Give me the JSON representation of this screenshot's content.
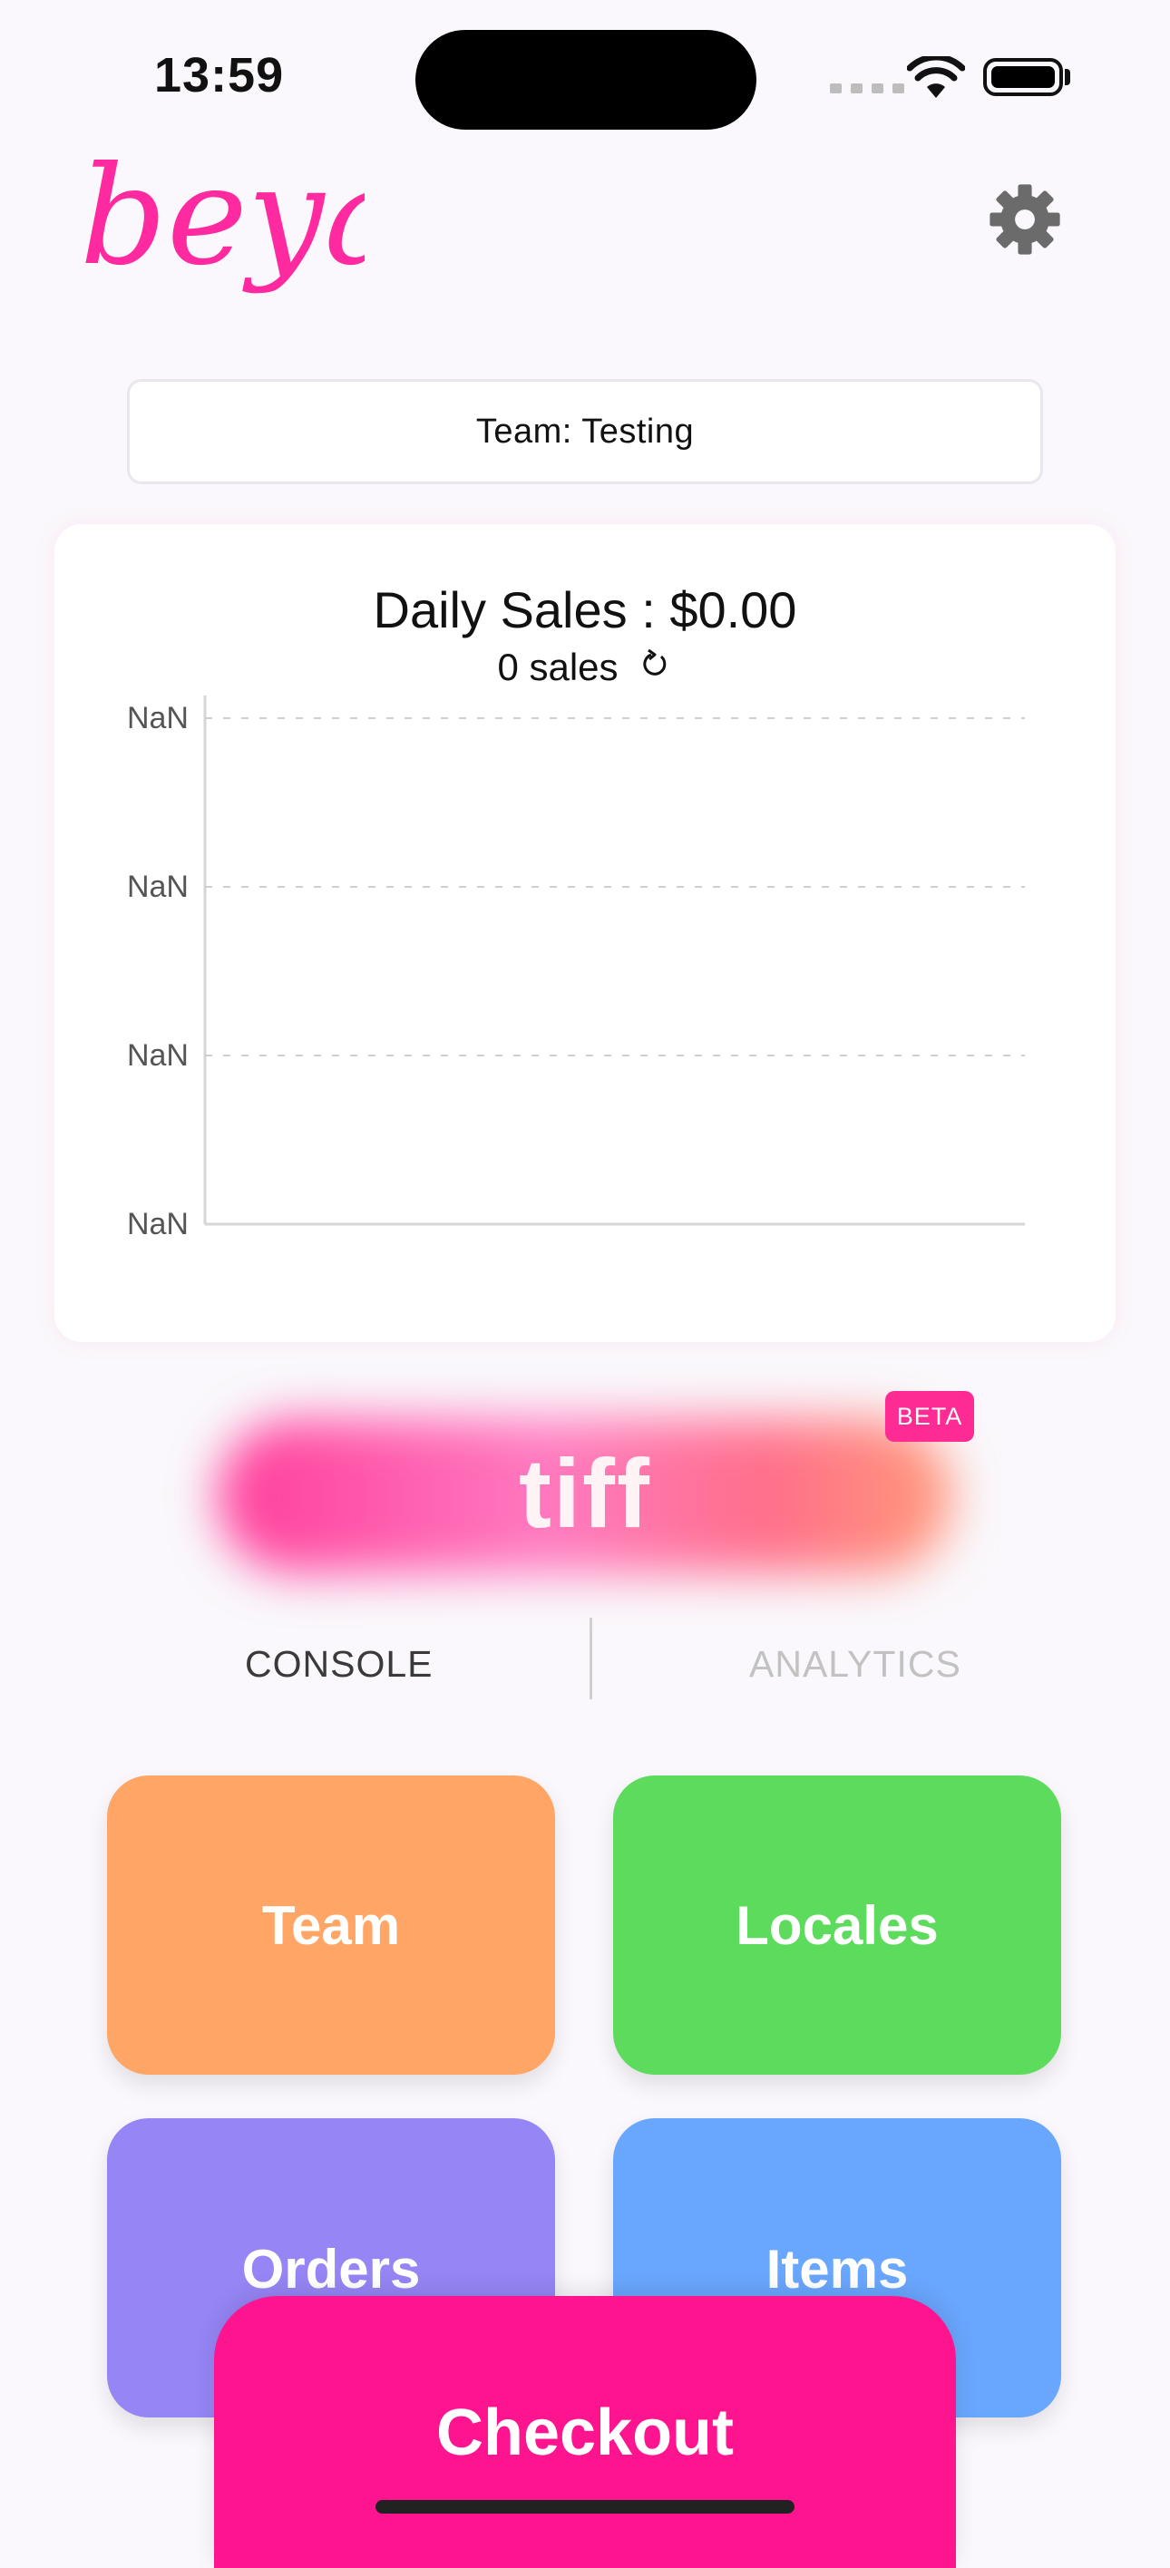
{
  "status_bar": {
    "time": "13:59"
  },
  "header": {
    "logo_text": "beya",
    "settings_icon": "gear-icon",
    "brand_color": "#ff2aa0"
  },
  "team_selector": {
    "label": "Team: Testing"
  },
  "sales_card": {
    "title": "Daily Sales : $0.00",
    "subtitle": "0 sales",
    "refresh_icon": "refresh-icon"
  },
  "chart_data": {
    "type": "line",
    "title": "Daily Sales : $0.00",
    "y_tick_labels": [
      "NaN",
      "NaN",
      "NaN",
      "NaN"
    ],
    "series": [],
    "grid": true
  },
  "tiff": {
    "label": "tiff",
    "badge": "BETA"
  },
  "tabs": [
    {
      "label": "CONSOLE",
      "active": true
    },
    {
      "label": "ANALYTICS",
      "active": false
    }
  ],
  "tiles": {
    "team": "Team",
    "locales": "Locales",
    "orders": "Orders",
    "items": "Items"
  },
  "checkout": {
    "label": "Checkout",
    "color": "#ff1490"
  }
}
